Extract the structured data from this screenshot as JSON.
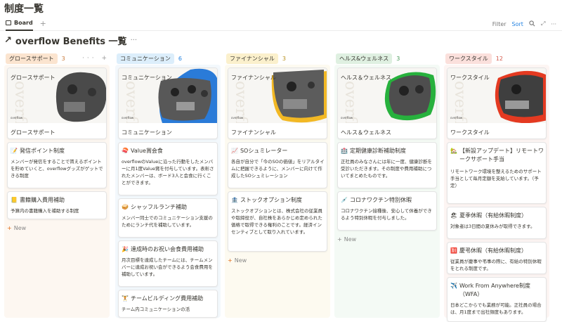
{
  "page": {
    "title": "制度一覧"
  },
  "view": {
    "tab_label": "Board",
    "filter": "Filter",
    "sort": "Sort"
  },
  "database": {
    "title": "overflow Benefits 一覧",
    "arrow": "↗",
    "more": "···"
  },
  "new_label": "New",
  "colors": {
    "orange": "#fbe4cf",
    "blue": "#dceefb",
    "yellow": "#fbf0cc",
    "green": "#dff0e1",
    "red": "#fbe0dc",
    "accent": "#2383e2"
  },
  "columns": [
    {
      "label": "グロースサポート",
      "count": "3",
      "cover_label": "グロースサポート",
      "cover_name": "グロースサポート",
      "logo": "overflow",
      "cards": [
        {
          "icon": "📝",
          "title": "発信ポイント制度",
          "desc": "メンバーが発信をすることで貰えるポイントを貯めていくと、overflowグッズがゲットできる制度"
        },
        {
          "icon": "📒",
          "title": "書籍購入費用補助",
          "desc": "予算内の書籍購入を補助する制度"
        }
      ]
    },
    {
      "label": "コミュニケーション",
      "count": "6",
      "cover_label": "コミュニケーション",
      "cover_name": "コミュニケーション",
      "logo": "overflow",
      "cards": [
        {
          "icon": "🍣",
          "title": "Value賞会食",
          "desc": "overflowのValueに沿った行動をしたメンバーに月1度Value賞を付与しています。表彰されたメンバーは、ボード3人と会食に行くことができます。"
        },
        {
          "icon": "🥪",
          "title": "シャッフルランチ補助",
          "desc": "メンバー同士でのコミュニケーション支援のためにランチ代を補助しています。"
        },
        {
          "icon": "🎉",
          "title": "達成時のお祝い会食費用補助",
          "desc": "月次目標を達成したチームには、チームメンバーに達成お祝い会ができるよう会食費用を補助しています。"
        },
        {
          "icon": "🏋",
          "title": "チームビルディング費用補助",
          "desc": "チーム内コミュニケーションの活"
        }
      ]
    },
    {
      "label": "ファイナンシャル",
      "count": "3",
      "cover_label": "ファイナンシャル",
      "cover_name": "ファイナンシャル",
      "logo": "overflow",
      "cards": [
        {
          "icon": "📈",
          "title": "SOシュミレーター",
          "desc": "各自が自分で「今のSOの価値」をリアルタイムに把握できるように、メンバーに向けて作成したSOシュミレーション"
        },
        {
          "icon": "🏦",
          "title": "ストックオプション制度",
          "desc": "ストックオプションとは、株式会社の従業員や取締役が、自社株をあらかじめ定められた価格で取得できる権利のことです。経済インセンティブとして取り入れています。"
        }
      ]
    },
    {
      "label": "ヘルス&ウェルネス",
      "count": "3",
      "cover_label": "ヘルス＆ウェルネス",
      "cover_name": "ヘルス＆ウェルネス",
      "logo": "overflow",
      "cards": [
        {
          "icon": "🏥",
          "title": "定期健康診断補助制度",
          "desc": "正社員のみなさんには年に一度、健康診断を受診いただきます。その制度や費用補助についてまとめたものです。"
        },
        {
          "icon": "💉",
          "title": "コロナワクチン特別休暇",
          "desc": "コロナワクチン接種後、安心して休養ができるよう特別休暇を付与しました。"
        }
      ]
    },
    {
      "label": "ワークスタイル",
      "count": "12",
      "cover_label": "ワークスタイル",
      "cover_name": "ワークスタイル",
      "logo": "overflow",
      "cards": [
        {
          "icon": "🏡",
          "title": "【新設アップデート】リモートワークサポート手当",
          "desc": "リモートワーク環境を整えるためのサポート手当として毎月定額を支給しています。（予定）"
        },
        {
          "icon": "🏖",
          "title": "夏季休暇（有給休暇制度）",
          "desc": "対象者は3日間の夏休みが取得できます。"
        },
        {
          "icon": "🈹",
          "title": "慶弔休暇（有給休暇制度）",
          "desc": "従業員が慶事や弔事の際に、有給の特別休暇をとれる制度です。"
        },
        {
          "icon": "✈️",
          "title": "Work From Anywhere制度（WFA）",
          "desc": "日本どこからでも業務が可能。正社員の場合は、月1度まで出社頻度もあります。"
        }
      ]
    }
  ]
}
